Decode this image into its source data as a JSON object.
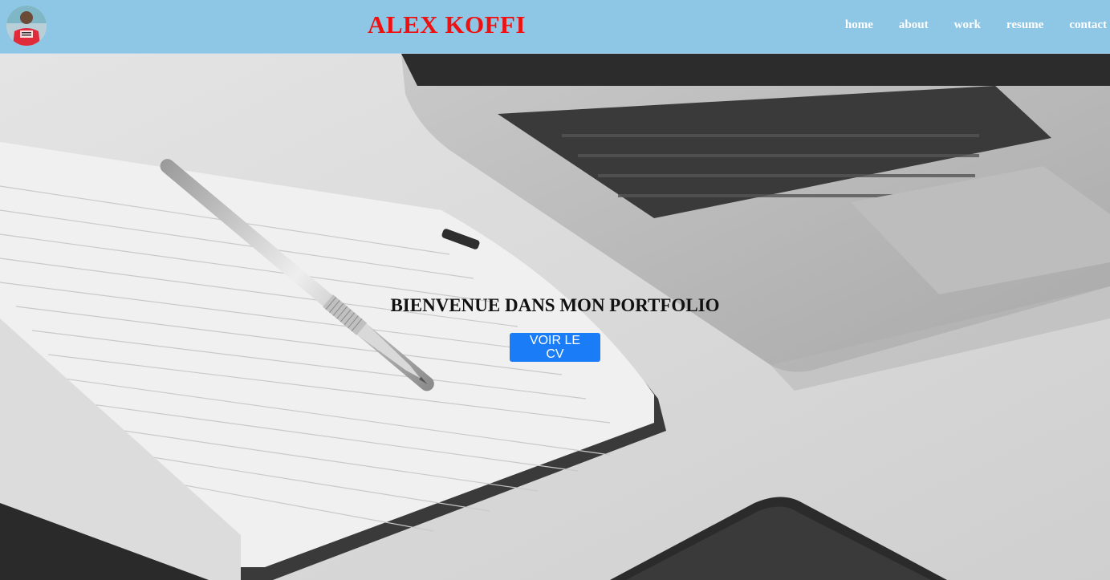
{
  "header": {
    "brand": "ALEX KOFFI",
    "avatar_icon": "profile-photo",
    "nav": [
      {
        "label": "home"
      },
      {
        "label": "about"
      },
      {
        "label": "work"
      },
      {
        "label": "resume"
      },
      {
        "label": "contact"
      }
    ]
  },
  "hero": {
    "title": "BIENVENUE DANS MON PORTFOLIO",
    "cv_button_label": "VOIR LE CV"
  },
  "colors": {
    "header_bg": "#8ec6e6",
    "brand": "#ee1111",
    "button_bg": "#1a7df7",
    "nav_text": "#ffffff"
  }
}
